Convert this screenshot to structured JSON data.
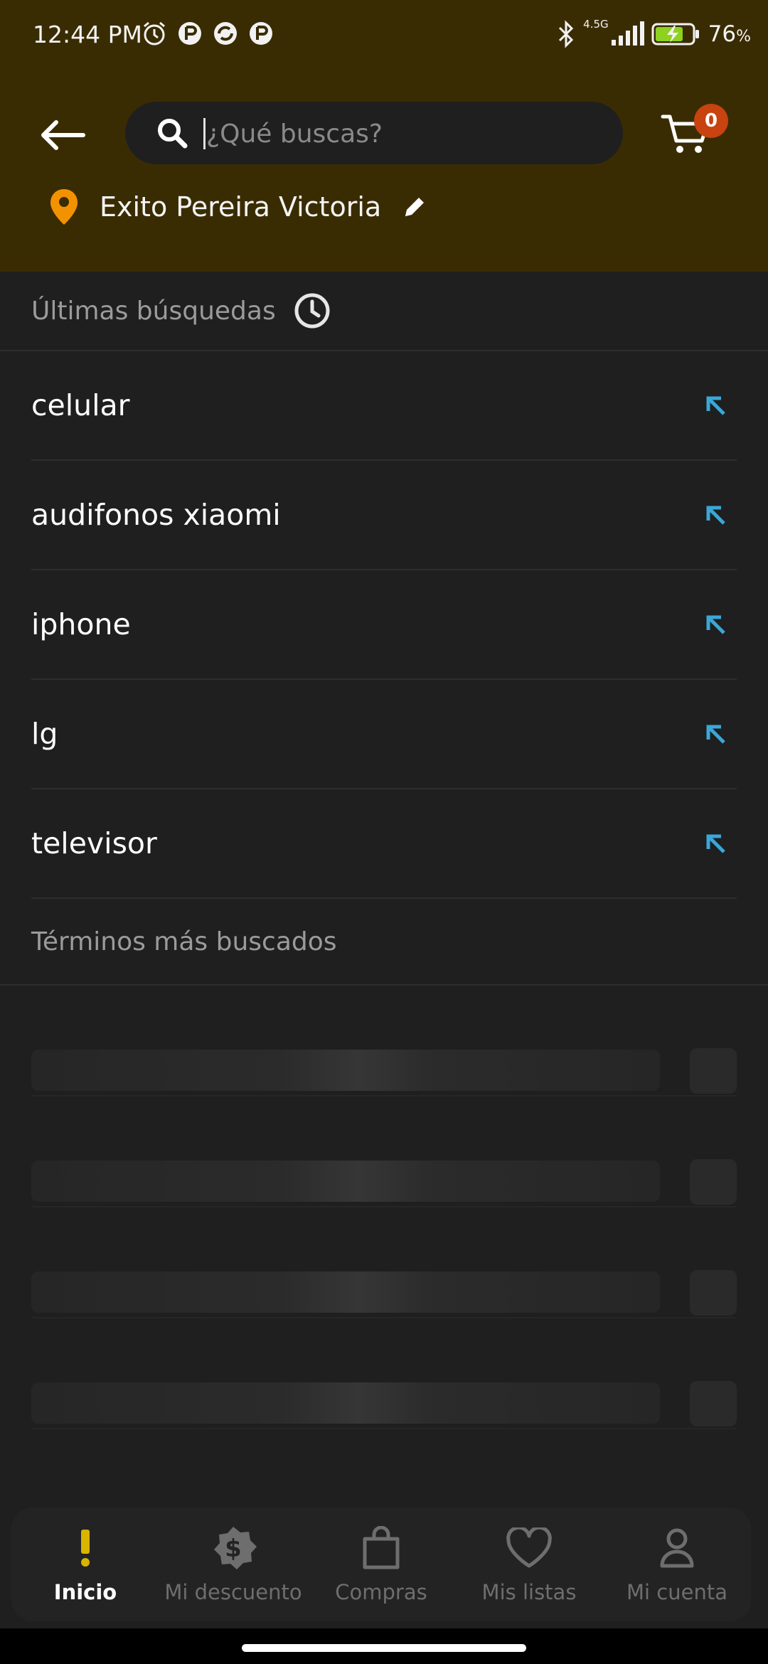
{
  "status_bar": {
    "time": "12:44 PM",
    "network": "4.5G",
    "battery": "76",
    "battery_unit": "%"
  },
  "header": {
    "search_placeholder": "¿Qué buscas?",
    "cart_count": "0",
    "location": "Exito Pereira Victoria"
  },
  "recent": {
    "title": "Últimas búsquedas",
    "items": [
      {
        "label": "celular"
      },
      {
        "label": "audifonos xiaomi"
      },
      {
        "label": "iphone"
      },
      {
        "label": "lg"
      },
      {
        "label": "televisor"
      }
    ]
  },
  "popular": {
    "title": "Términos más buscados"
  },
  "nav": {
    "items": [
      {
        "label": "Inicio",
        "icon": "exclamation-icon"
      },
      {
        "label": "Mi descuento",
        "icon": "discount-tag-icon"
      },
      {
        "label": "Compras",
        "icon": "shopping-bag-icon"
      },
      {
        "label": "Mis listas",
        "icon": "heart-icon"
      },
      {
        "label": "Mi cuenta",
        "icon": "user-icon"
      }
    ]
  },
  "colors": {
    "header_bg": "#3a2c02",
    "accent_yellow": "#d9b400",
    "arrow_blue": "#3aa7d8",
    "badge_red": "#c8430f",
    "pin_orange": "#f39200"
  }
}
